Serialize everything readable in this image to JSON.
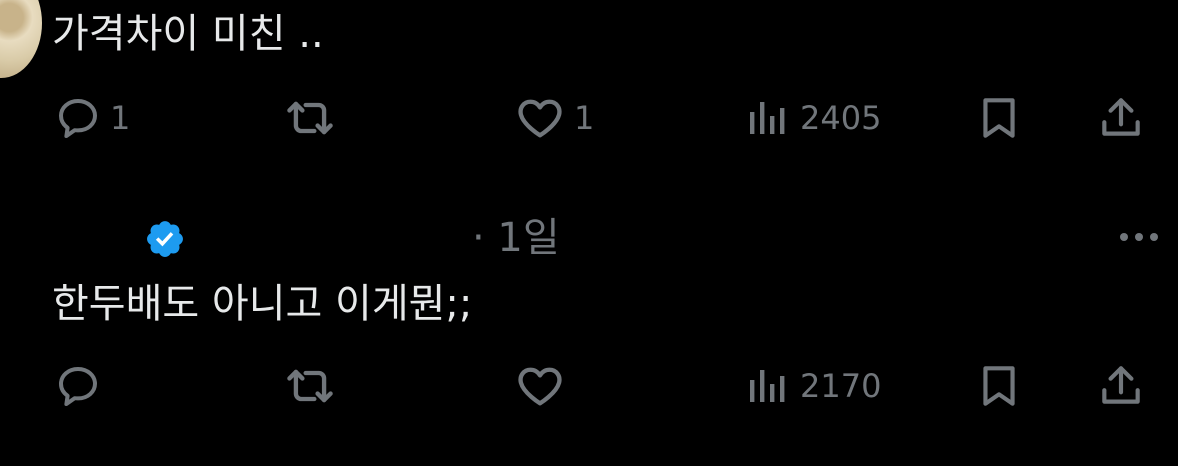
{
  "tweets": [
    {
      "text": "가격차이 미친 ..",
      "reply_count": "1",
      "retweet_count": "",
      "like_count": "1",
      "view_count": "2405"
    },
    {
      "timestamp": "· 1일",
      "text": "한두배도 아니고 이게뭔;;",
      "reply_count": "",
      "retweet_count": "",
      "like_count": "",
      "view_count": "2170"
    }
  ],
  "icons": {
    "reply": "reply-icon",
    "retweet": "retweet-icon",
    "like": "heart-icon",
    "views": "views-icon",
    "bookmark": "bookmark-icon",
    "share": "share-icon",
    "verified": "verified-badge-icon",
    "more": "more-icon"
  },
  "colors": {
    "background": "#000000",
    "text": "#e7e9ea",
    "secondary": "#71767b",
    "verified": "#1d9bf0"
  }
}
